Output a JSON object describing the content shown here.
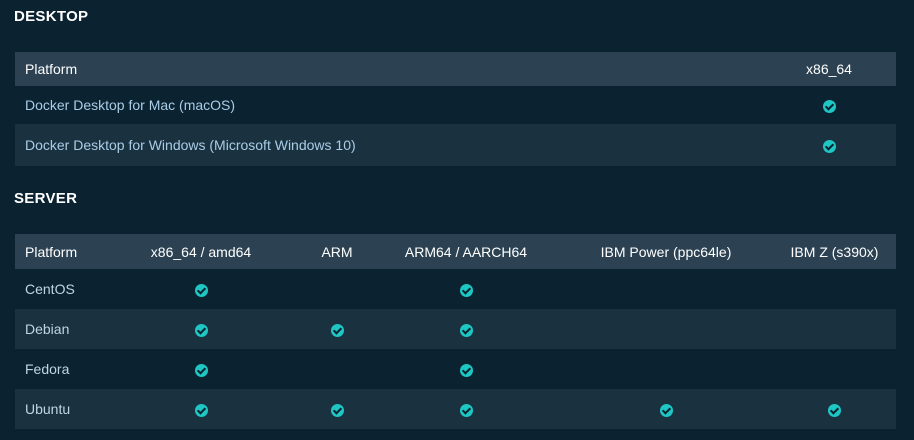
{
  "desktop": {
    "heading": "DESKTOP",
    "columns": [
      "Platform",
      "x86_64"
    ],
    "rows": [
      {
        "platform": "Docker Desktop for Mac (macOS)",
        "x86_64": true
      },
      {
        "platform": "Docker Desktop for Windows (Microsoft Windows 10)",
        "x86_64": true
      }
    ]
  },
  "server": {
    "heading": "SERVER",
    "columns": [
      "Platform",
      "x86_64 / amd64",
      "ARM",
      "ARM64 / AARCH64",
      "IBM Power (ppc64le)",
      "IBM Z (s390x)"
    ],
    "rows": [
      {
        "platform": "CentOS",
        "support": [
          true,
          false,
          true,
          false,
          false
        ]
      },
      {
        "platform": "Debian",
        "support": [
          true,
          true,
          true,
          false,
          false
        ]
      },
      {
        "platform": "Fedora",
        "support": [
          true,
          false,
          true,
          false,
          false
        ]
      },
      {
        "platform": "Ubuntu",
        "support": [
          true,
          true,
          true,
          true,
          true
        ]
      }
    ]
  },
  "icons": {
    "supported": "check-circle-icon"
  },
  "colors": {
    "background": "#0b2231",
    "header_row": "#2c4252",
    "stripe_row": "#1a3140",
    "check": "#1ec7c4"
  }
}
